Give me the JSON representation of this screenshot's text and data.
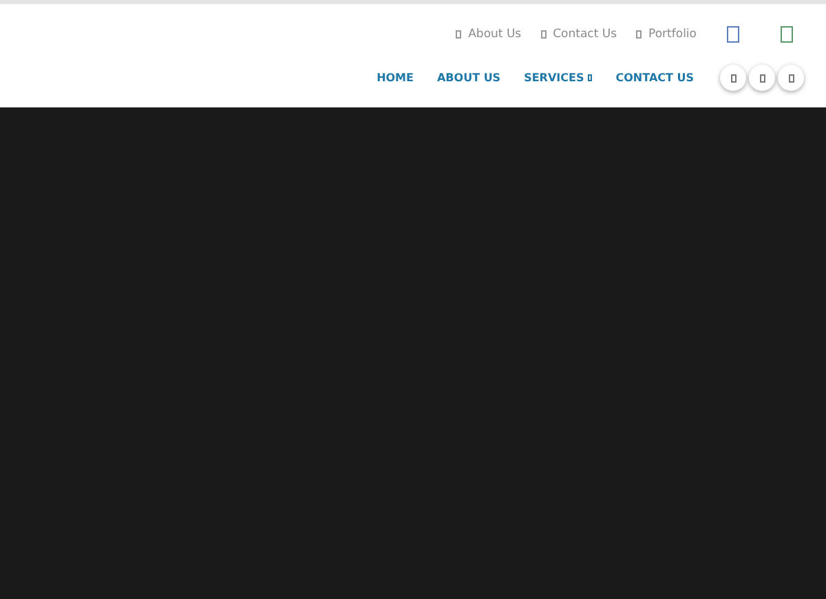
{
  "top_links": [
    {
      "label": "About Us"
    },
    {
      "label": "Contact Us"
    },
    {
      "label": "Portfolio"
    }
  ],
  "nav": [
    {
      "label": "HOME",
      "dropdown": false
    },
    {
      "label": "ABOUT US",
      "dropdown": false
    },
    {
      "label": "SERVICES",
      "dropdown": true
    },
    {
      "label": "CONTACT US",
      "dropdown": false
    }
  ],
  "hero": {
    "kind": "dark"
  }
}
